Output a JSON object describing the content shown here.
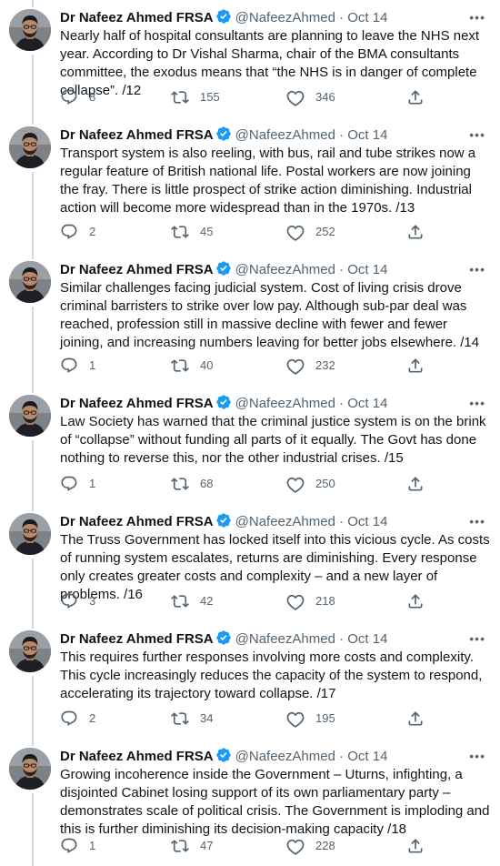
{
  "author": {
    "name": "Dr Nafeez Ahmed FRSA",
    "handle": "@NafeezAhmed",
    "separator": "·"
  },
  "more_label": "•••",
  "tweets": [
    {
      "date": "Oct 14",
      "text": "Nearly half of hospital consultants are planning to leave the NHS next year. According to Dr Vishal Sharma, chair of the BMA consultants committee, the exodus means that “the NHS is in danger of complete collapse”. /12",
      "replies": "8",
      "retweets": "155",
      "likes": "346"
    },
    {
      "date": "Oct 14",
      "text": "Transport system is also reeling, with bus, rail and tube strikes now a regular feature of British national life. Postal workers are now joining the fray. There is little prospect of strike action diminishing. Industrial action will become more widespread than in the 1970s. /13",
      "replies": "2",
      "retweets": "45",
      "likes": "252"
    },
    {
      "date": "Oct 14",
      "text": "Similar challenges facing judicial system. Cost of living crisis drove criminal barristers to strike over low pay. Although sub-par deal was reached, profession still in massive decline with fewer and fewer joining, and increasing numbers leaving for better jobs elsewhere. /14",
      "replies": "1",
      "retweets": "40",
      "likes": "232"
    },
    {
      "date": "Oct 14",
      "text": "Law Society has warned that the criminal justice system is on the brink of “collapse” without funding all parts of it equally. The Govt has done nothing to reverse this, nor the other industrial crises. /15",
      "replies": "1",
      "retweets": "68",
      "likes": "250"
    },
    {
      "date": "Oct 14",
      "text": "The Truss Government has locked itself into this vicious cycle. As costs of running system escalates, returns are diminishing. Every response only creates greater costs and complexity – and a new layer of problems. /16",
      "replies": "3",
      "retweets": "42",
      "likes": "218"
    },
    {
      "date": "Oct 14",
      "text": "This requires further responses involving more costs and complexity. This cycle increasingly reduces the capacity of the system to respond, accelerating its trajectory toward collapse. /17",
      "replies": "2",
      "retweets": "34",
      "likes": "195"
    },
    {
      "date": "Oct 14",
      "text": "Growing incoherence inside the Government – Uturns, infighting, a disjointed Cabinet losing support of its own parliamentary party – demonstrates scale of political crisis. The Government is imploding and this is further diminishing its decision-making capacity /18",
      "replies": "1",
      "retweets": "47",
      "likes": "228"
    }
  ]
}
